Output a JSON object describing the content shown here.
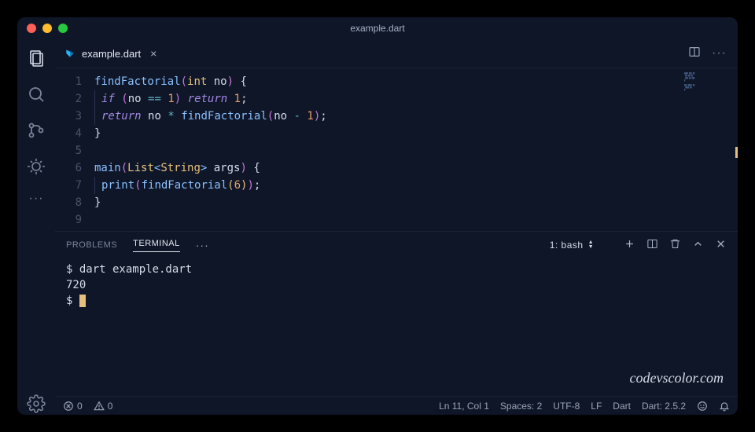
{
  "window": {
    "title": "example.dart"
  },
  "tab": {
    "filename": "example.dart",
    "icon_color": "#29b6f6"
  },
  "editor": {
    "line_count": 9,
    "tokens": [
      [
        {
          "t": "findFactorial",
          "c": "tok-fn"
        },
        {
          "t": "(",
          "c": "tok-paren"
        },
        {
          "t": "int",
          "c": "tok-type"
        },
        {
          "t": " ",
          "c": ""
        },
        {
          "t": "no",
          "c": "tok-var"
        },
        {
          "t": ")",
          "c": "tok-paren"
        },
        {
          "t": " {",
          "c": "tok-punct"
        }
      ],
      [
        {
          "t": "  ",
          "c": ""
        },
        {
          "t": "if",
          "c": "tok-kw"
        },
        {
          "t": " ",
          "c": ""
        },
        {
          "t": "(",
          "c": "tok-paren"
        },
        {
          "t": "no ",
          "c": "tok-var"
        },
        {
          "t": "==",
          "c": "tok-op"
        },
        {
          "t": " ",
          "c": ""
        },
        {
          "t": "1",
          "c": "tok-num"
        },
        {
          "t": ")",
          "c": "tok-paren"
        },
        {
          "t": " ",
          "c": ""
        },
        {
          "t": "return",
          "c": "tok-kw"
        },
        {
          "t": " ",
          "c": ""
        },
        {
          "t": "1",
          "c": "tok-num"
        },
        {
          "t": ";",
          "c": "tok-punct"
        }
      ],
      [
        {
          "t": "  ",
          "c": ""
        },
        {
          "t": "return",
          "c": "tok-kw"
        },
        {
          "t": " ",
          "c": ""
        },
        {
          "t": "no ",
          "c": "tok-var"
        },
        {
          "t": "*",
          "c": "tok-op"
        },
        {
          "t": " ",
          "c": ""
        },
        {
          "t": "findFactorial",
          "c": "tok-fn"
        },
        {
          "t": "(",
          "c": "tok-paren"
        },
        {
          "t": "no ",
          "c": "tok-var"
        },
        {
          "t": "-",
          "c": "tok-op"
        },
        {
          "t": " ",
          "c": ""
        },
        {
          "t": "1",
          "c": "tok-num"
        },
        {
          "t": ")",
          "c": "tok-paren"
        },
        {
          "t": ";",
          "c": "tok-punct"
        }
      ],
      [
        {
          "t": "}",
          "c": "tok-punct"
        }
      ],
      [],
      [
        {
          "t": "main",
          "c": "tok-fn"
        },
        {
          "t": "(",
          "c": "tok-paren"
        },
        {
          "t": "List",
          "c": "tok-type"
        },
        {
          "t": "<",
          "c": "tok-angle"
        },
        {
          "t": "String",
          "c": "tok-type"
        },
        {
          "t": ">",
          "c": "tok-angle"
        },
        {
          "t": " args",
          "c": "tok-var"
        },
        {
          "t": ")",
          "c": "tok-paren"
        },
        {
          "t": " {",
          "c": "tok-punct"
        }
      ],
      [
        {
          "t": "  ",
          "c": ""
        },
        {
          "t": "print",
          "c": "tok-fn"
        },
        {
          "t": "(",
          "c": "tok-paren"
        },
        {
          "t": "findFactorial",
          "c": "tok-fn"
        },
        {
          "t": "(",
          "c": "tok-paren2"
        },
        {
          "t": "6",
          "c": "tok-num"
        },
        {
          "t": ")",
          "c": "tok-paren2"
        },
        {
          "t": ")",
          "c": "tok-paren"
        },
        {
          "t": ";",
          "c": "tok-punct"
        }
      ],
      [
        {
          "t": "}",
          "c": "tok-punct"
        }
      ],
      []
    ]
  },
  "panel": {
    "tabs": {
      "problems": "PROBLEMS",
      "terminal": "TERMINAL"
    },
    "terminal_select": "1: bash",
    "terminal_lines": [
      "$ dart example.dart",
      "720",
      "$ "
    ]
  },
  "statusbar": {
    "errors": "0",
    "warnings": "0",
    "cursor": "Ln 11, Col 1",
    "spaces": "Spaces: 2",
    "encoding": "UTF-8",
    "eol": "LF",
    "language": "Dart",
    "sdk": "Dart: 2.5.2"
  },
  "watermark": "codevscolor.com"
}
